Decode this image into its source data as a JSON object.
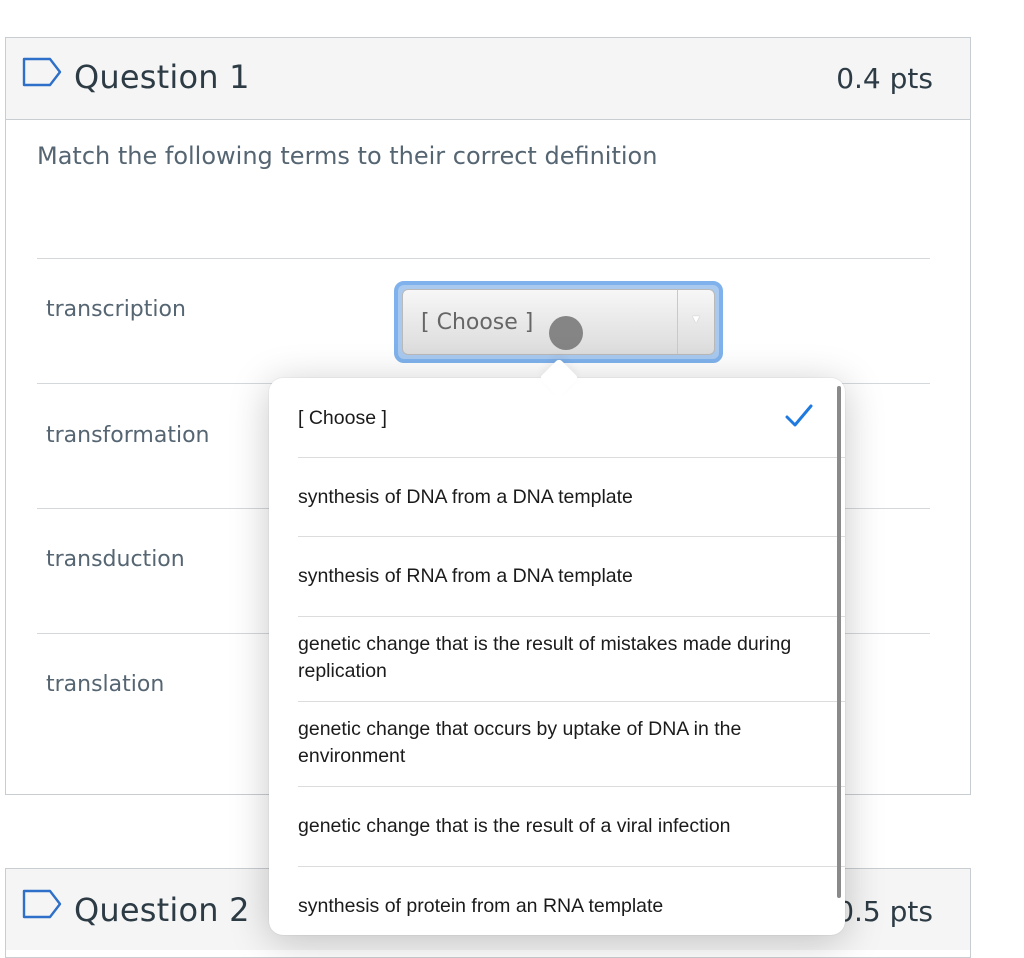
{
  "question1": {
    "title": "Question 1",
    "points": "0.4 pts",
    "prompt": "Match the following terms to their correct definition",
    "rows": [
      {
        "label": "transcription"
      },
      {
        "label": "transformation"
      },
      {
        "label": "transduction"
      },
      {
        "label": "translation"
      }
    ],
    "select": {
      "value": "[ Choose ]"
    }
  },
  "dropdown": {
    "options": [
      {
        "label": "[ Choose ]",
        "selected": true
      },
      {
        "label": "synthesis of DNA from a DNA template"
      },
      {
        "label": "synthesis of RNA from a DNA template"
      },
      {
        "label": "genetic change that is the result of mistakes made during replication"
      },
      {
        "label": "genetic change that occurs by uptake of DNA in the environment"
      },
      {
        "label": "genetic change that is the result of a viral infection"
      },
      {
        "label": "synthesis of protein from an RNA template"
      }
    ]
  },
  "question2": {
    "title": "Question 2",
    "points": "0.5 pts",
    "points_visible_fragment": ")5 pts"
  },
  "colors": {
    "accent": "#1f7ae0",
    "select_focus": "#7fb2ec",
    "text": "#2d3b45",
    "muted_text": "#556572",
    "header_bg": "#f5f5f5"
  },
  "icons": {
    "question_flag": "flag-icon",
    "checkmark": "check-icon",
    "select_caret": "caret-down-icon"
  }
}
